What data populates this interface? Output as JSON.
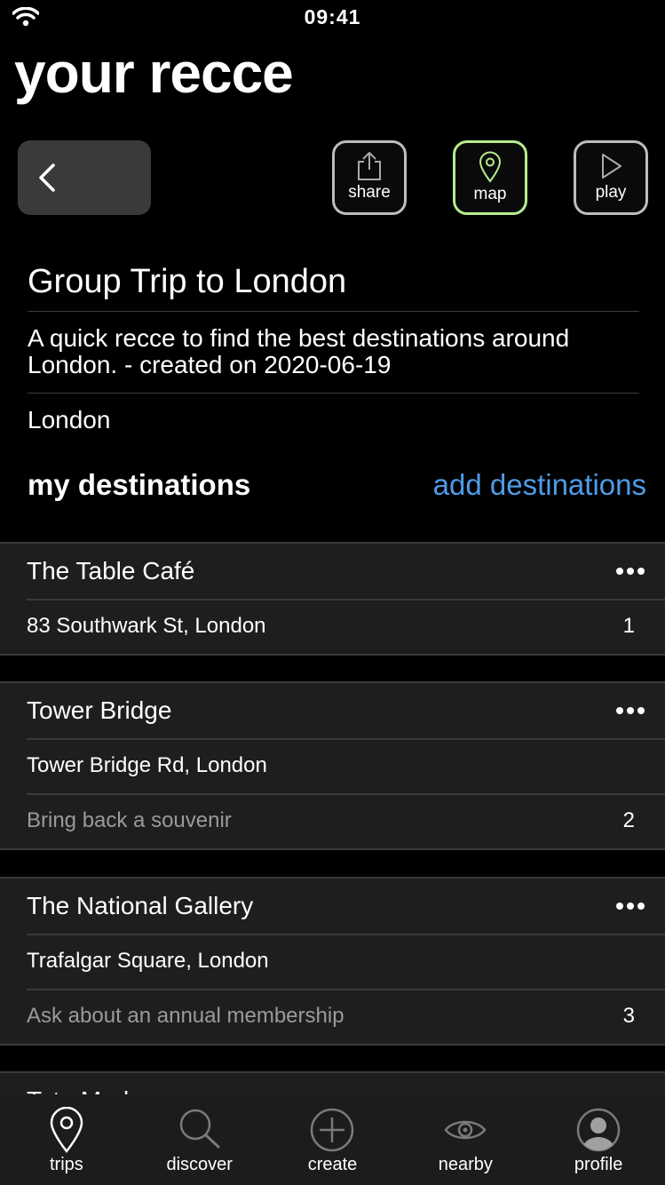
{
  "status_bar": {
    "time": "09:41"
  },
  "header": {
    "title": "your recce"
  },
  "toolbar": {
    "share_label": "share",
    "map_label": "map",
    "play_label": "play",
    "active": "map",
    "active_color": "#b7ec8e"
  },
  "trip": {
    "title": "Group Trip to London",
    "description": "A quick recce to find the best destinations around London. - created on 2020-06-19",
    "city": "London"
  },
  "destinations_section": {
    "heading": "my destinations",
    "add_label": "add destinations",
    "link_color": "#4f9be8"
  },
  "destinations": [
    {
      "name": "The Table Café",
      "address": "83 Southwark St, London",
      "note": "",
      "number": "1"
    },
    {
      "name": "Tower Bridge",
      "address": "Tower Bridge Rd, London",
      "note": "Bring back a souvenir",
      "number": "2"
    },
    {
      "name": "The National Gallery",
      "address": "Trafalgar Square, London",
      "note": "Ask about an annual membership",
      "number": "3"
    },
    {
      "name": "Tate Modern",
      "address": "",
      "note": "",
      "number": ""
    }
  ],
  "tab_bar": {
    "items": [
      {
        "label": "trips",
        "icon": "location-pin-icon"
      },
      {
        "label": "discover",
        "icon": "search-icon"
      },
      {
        "label": "create",
        "icon": "plus-circle-icon"
      },
      {
        "label": "nearby",
        "icon": "eye-icon"
      },
      {
        "label": "profile",
        "icon": "avatar-icon"
      }
    ],
    "active": "trips"
  }
}
